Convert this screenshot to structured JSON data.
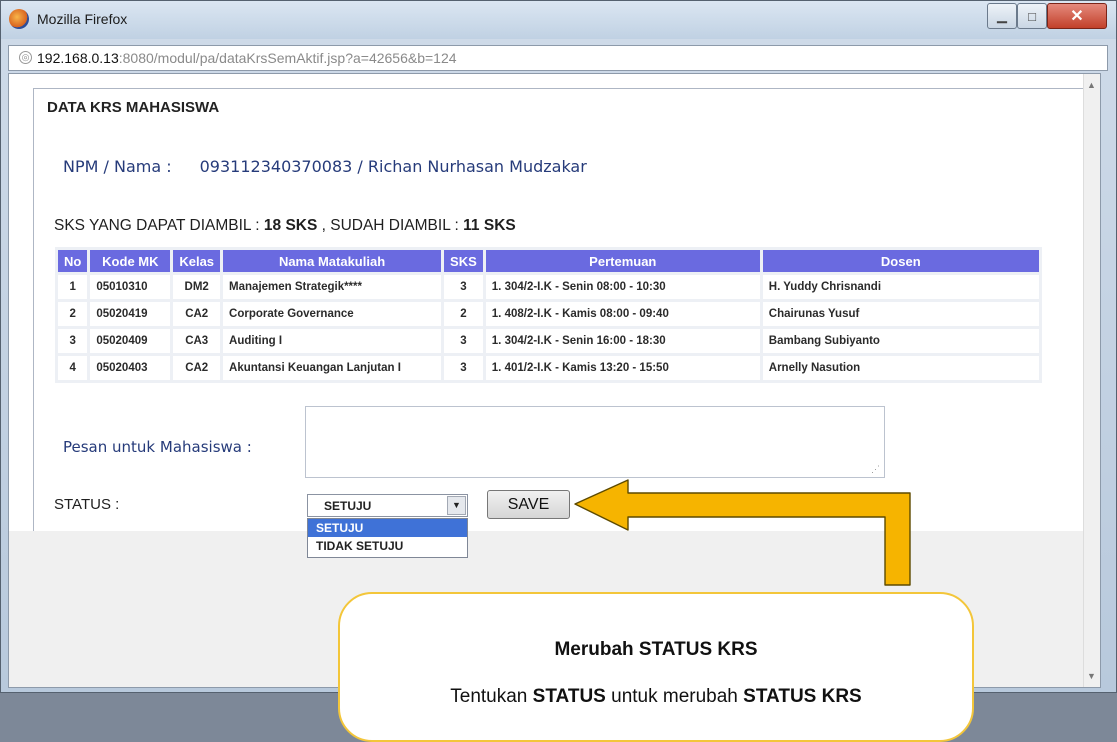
{
  "window": {
    "title": "Mozilla Firefox",
    "url_host": "192.168.0.13",
    "url_path": ":8080/modul/pa/dataKrsSemAktif.jsp?a=42656&b=124"
  },
  "page": {
    "title": "DATA KRS MAHASISWA",
    "npm_label": "NPM / Nama :",
    "npm_value": "093112340370083 / Richan Nurhasan Mudzakar",
    "sks_prefix": "SKS YANG DAPAT DIAMBIL : ",
    "sks_available": "18",
    "sks_unit": "SKS",
    "sks_middle": " , SUDAH DIAMBIL : ",
    "sks_taken": "11"
  },
  "table": {
    "headers": [
      "No",
      "Kode MK",
      "Kelas",
      "Nama Matakuliah",
      "SKS",
      "Pertemuan",
      "Dosen"
    ],
    "rows": [
      [
        "1",
        "05010310",
        "DM2",
        "Manajemen Strategik****",
        "3",
        "1. 304/2-I.K - Senin 08:00 - 10:30",
        "H. Yuddy Chrisnandi"
      ],
      [
        "2",
        "05020419",
        "CA2",
        "Corporate Governance",
        "2",
        "1. 408/2-I.K - Kamis 08:00 - 09:40",
        "Chairunas Yusuf"
      ],
      [
        "3",
        "05020409",
        "CA3",
        "Auditing I",
        "3",
        "1. 304/2-I.K - Senin 16:00 - 18:30",
        "Bambang Subiyanto"
      ],
      [
        "4",
        "05020403",
        "CA2",
        "Akuntansi Keuangan Lanjutan I",
        "3",
        "1. 401/2-I.K - Kamis 13:20 - 15:50",
        "Arnelly Nasution"
      ]
    ]
  },
  "form": {
    "pesan_label": "Pesan untuk Mahasiswa :",
    "pesan_value": "",
    "status_label": "STATUS :",
    "status_selected": "SETUJU",
    "status_options": [
      "SETUJU",
      "TIDAK SETUJU"
    ],
    "save_label": "SAVE"
  },
  "callout": {
    "title": "Merubah STATUS KRS",
    "text_1": "Tentukan ",
    "text_2": "STATUS",
    "text_3": " untuk merubah ",
    "text_4": "STATUS KRS"
  },
  "colors": {
    "table_header": "#6a6ae0",
    "arrow_fill": "#f6b400",
    "callout_border": "#f3c63a",
    "selected_option": "#3f72d7"
  }
}
